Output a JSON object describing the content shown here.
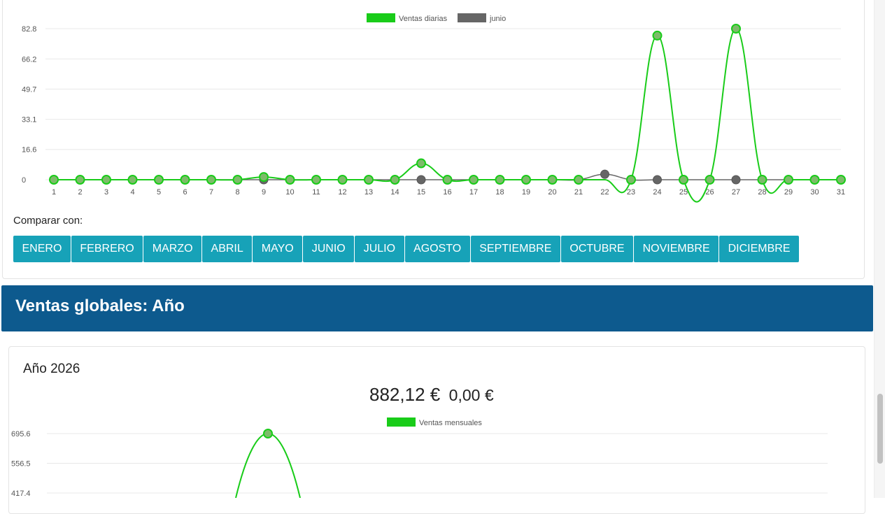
{
  "daily_section": {
    "compare_label": "Comparar con:",
    "months": [
      "ENERO",
      "FEBRERO",
      "MARZO",
      "ABRIL",
      "MAYO",
      "JUNIO",
      "JULIO",
      "AGOSTO",
      "SEPTIEMBRE",
      "OCTUBRE",
      "NOVIEMBRE",
      "DICIEMBRE"
    ]
  },
  "yearly_section": {
    "header_title": "Ventas globales: Año",
    "year_title": "Año 2026",
    "total_main": "882,12 €",
    "total_compare": "0,00 €"
  },
  "colors": {
    "series_current": "#19cc19",
    "series_compare": "#666666",
    "button_bg": "#17a2b8",
    "header_bg": "#0d5a8e"
  },
  "chart_data": [
    {
      "type": "line",
      "title": "",
      "x": [
        1,
        2,
        3,
        4,
        5,
        6,
        7,
        8,
        9,
        10,
        11,
        12,
        13,
        14,
        15,
        16,
        17,
        18,
        19,
        20,
        21,
        22,
        23,
        24,
        25,
        26,
        27,
        28,
        29,
        30,
        31
      ],
      "y_ticks": [
        "0",
        "16.6",
        "33.1",
        "49.7",
        "66.2",
        "82.8"
      ],
      "ylim": [
        0,
        82.8
      ],
      "grid": true,
      "legend": "top-center",
      "series": [
        {
          "name": "Ventas diarias",
          "values": [
            0,
            0,
            0,
            0,
            0,
            0,
            0,
            0,
            1.5,
            0,
            0,
            0,
            0,
            0,
            9,
            0,
            0,
            0,
            0,
            0,
            0,
            0,
            0,
            79,
            0,
            0,
            82.8,
            0,
            0,
            0,
            0
          ]
        },
        {
          "name": "junio",
          "values": [
            0,
            0,
            0,
            0,
            0,
            0,
            0,
            0,
            0,
            0,
            0,
            0,
            0,
            0,
            0,
            0,
            0,
            0,
            0,
            0,
            0,
            3,
            0,
            0,
            0,
            0,
            0,
            0,
            0,
            0,
            0
          ]
        }
      ]
    },
    {
      "type": "line",
      "title": "",
      "y_ticks": [
        "417.4",
        "556.5",
        "695.6"
      ],
      "ylim": [
        0,
        695.6
      ],
      "grid": true,
      "legend": "top-center",
      "series": [
        {
          "name": "Ventas mensuales",
          "values": [
            null,
            null,
            695.6
          ]
        }
      ]
    }
  ]
}
